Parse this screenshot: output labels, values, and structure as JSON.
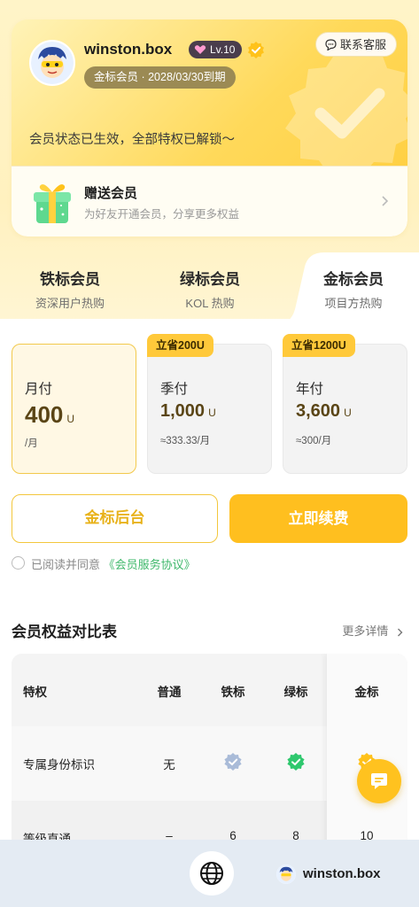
{
  "profile": {
    "username": "winston.box",
    "level": "Lv.10",
    "expiry": "金标会员 · 2028/03/30到期",
    "status": "会员状态已生效，全部特权已解锁～"
  },
  "service": {
    "label": "联系客服"
  },
  "gift": {
    "title": "赠送会员",
    "subtitle": "为好友开通会员，分享更多权益"
  },
  "tiers": [
    {
      "title": "铁标会员",
      "subtitle": "资深用户热购"
    },
    {
      "title": "绿标会员",
      "subtitle": "KOL 热购"
    },
    {
      "title": "金标会员",
      "subtitle": "项目方热购"
    }
  ],
  "plans": [
    {
      "name": "月付",
      "price": "400",
      "unit": "U",
      "per": "/月",
      "tag": "",
      "selected": true
    },
    {
      "name": "季付",
      "price": "1,000",
      "unit": "U",
      "per": "≈333.33/月",
      "tag": "立省200U",
      "selected": false
    },
    {
      "name": "年付",
      "price": "3,600",
      "unit": "U",
      "per": "≈300/月",
      "tag": "立省1200U",
      "selected": false
    }
  ],
  "actions": {
    "dashboard": "金标后台",
    "renew": "立即续费"
  },
  "agreement": {
    "prefix": "已阅读并同意",
    "link": "《会员服务协议》"
  },
  "compare": {
    "title": "会员权益对比表",
    "more": "更多详情",
    "headers": [
      "特权",
      "普通",
      "铁标",
      "绿标",
      "金标"
    ],
    "rows": [
      {
        "label": "专属身份标识",
        "normal": "无",
        "iron": "iron-check-icon",
        "green": "green-check-icon",
        "gold": "gold-check-icon"
      },
      {
        "label": "等级直通",
        "normal": "–",
        "iron": "6",
        "green": "8",
        "gold": "10"
      }
    ]
  },
  "bottom_bar": {
    "username": "winston.box"
  },
  "colors": {
    "accent": "#ffbf1f",
    "gold_text": "#5a4516",
    "link": "#3fb86b"
  }
}
